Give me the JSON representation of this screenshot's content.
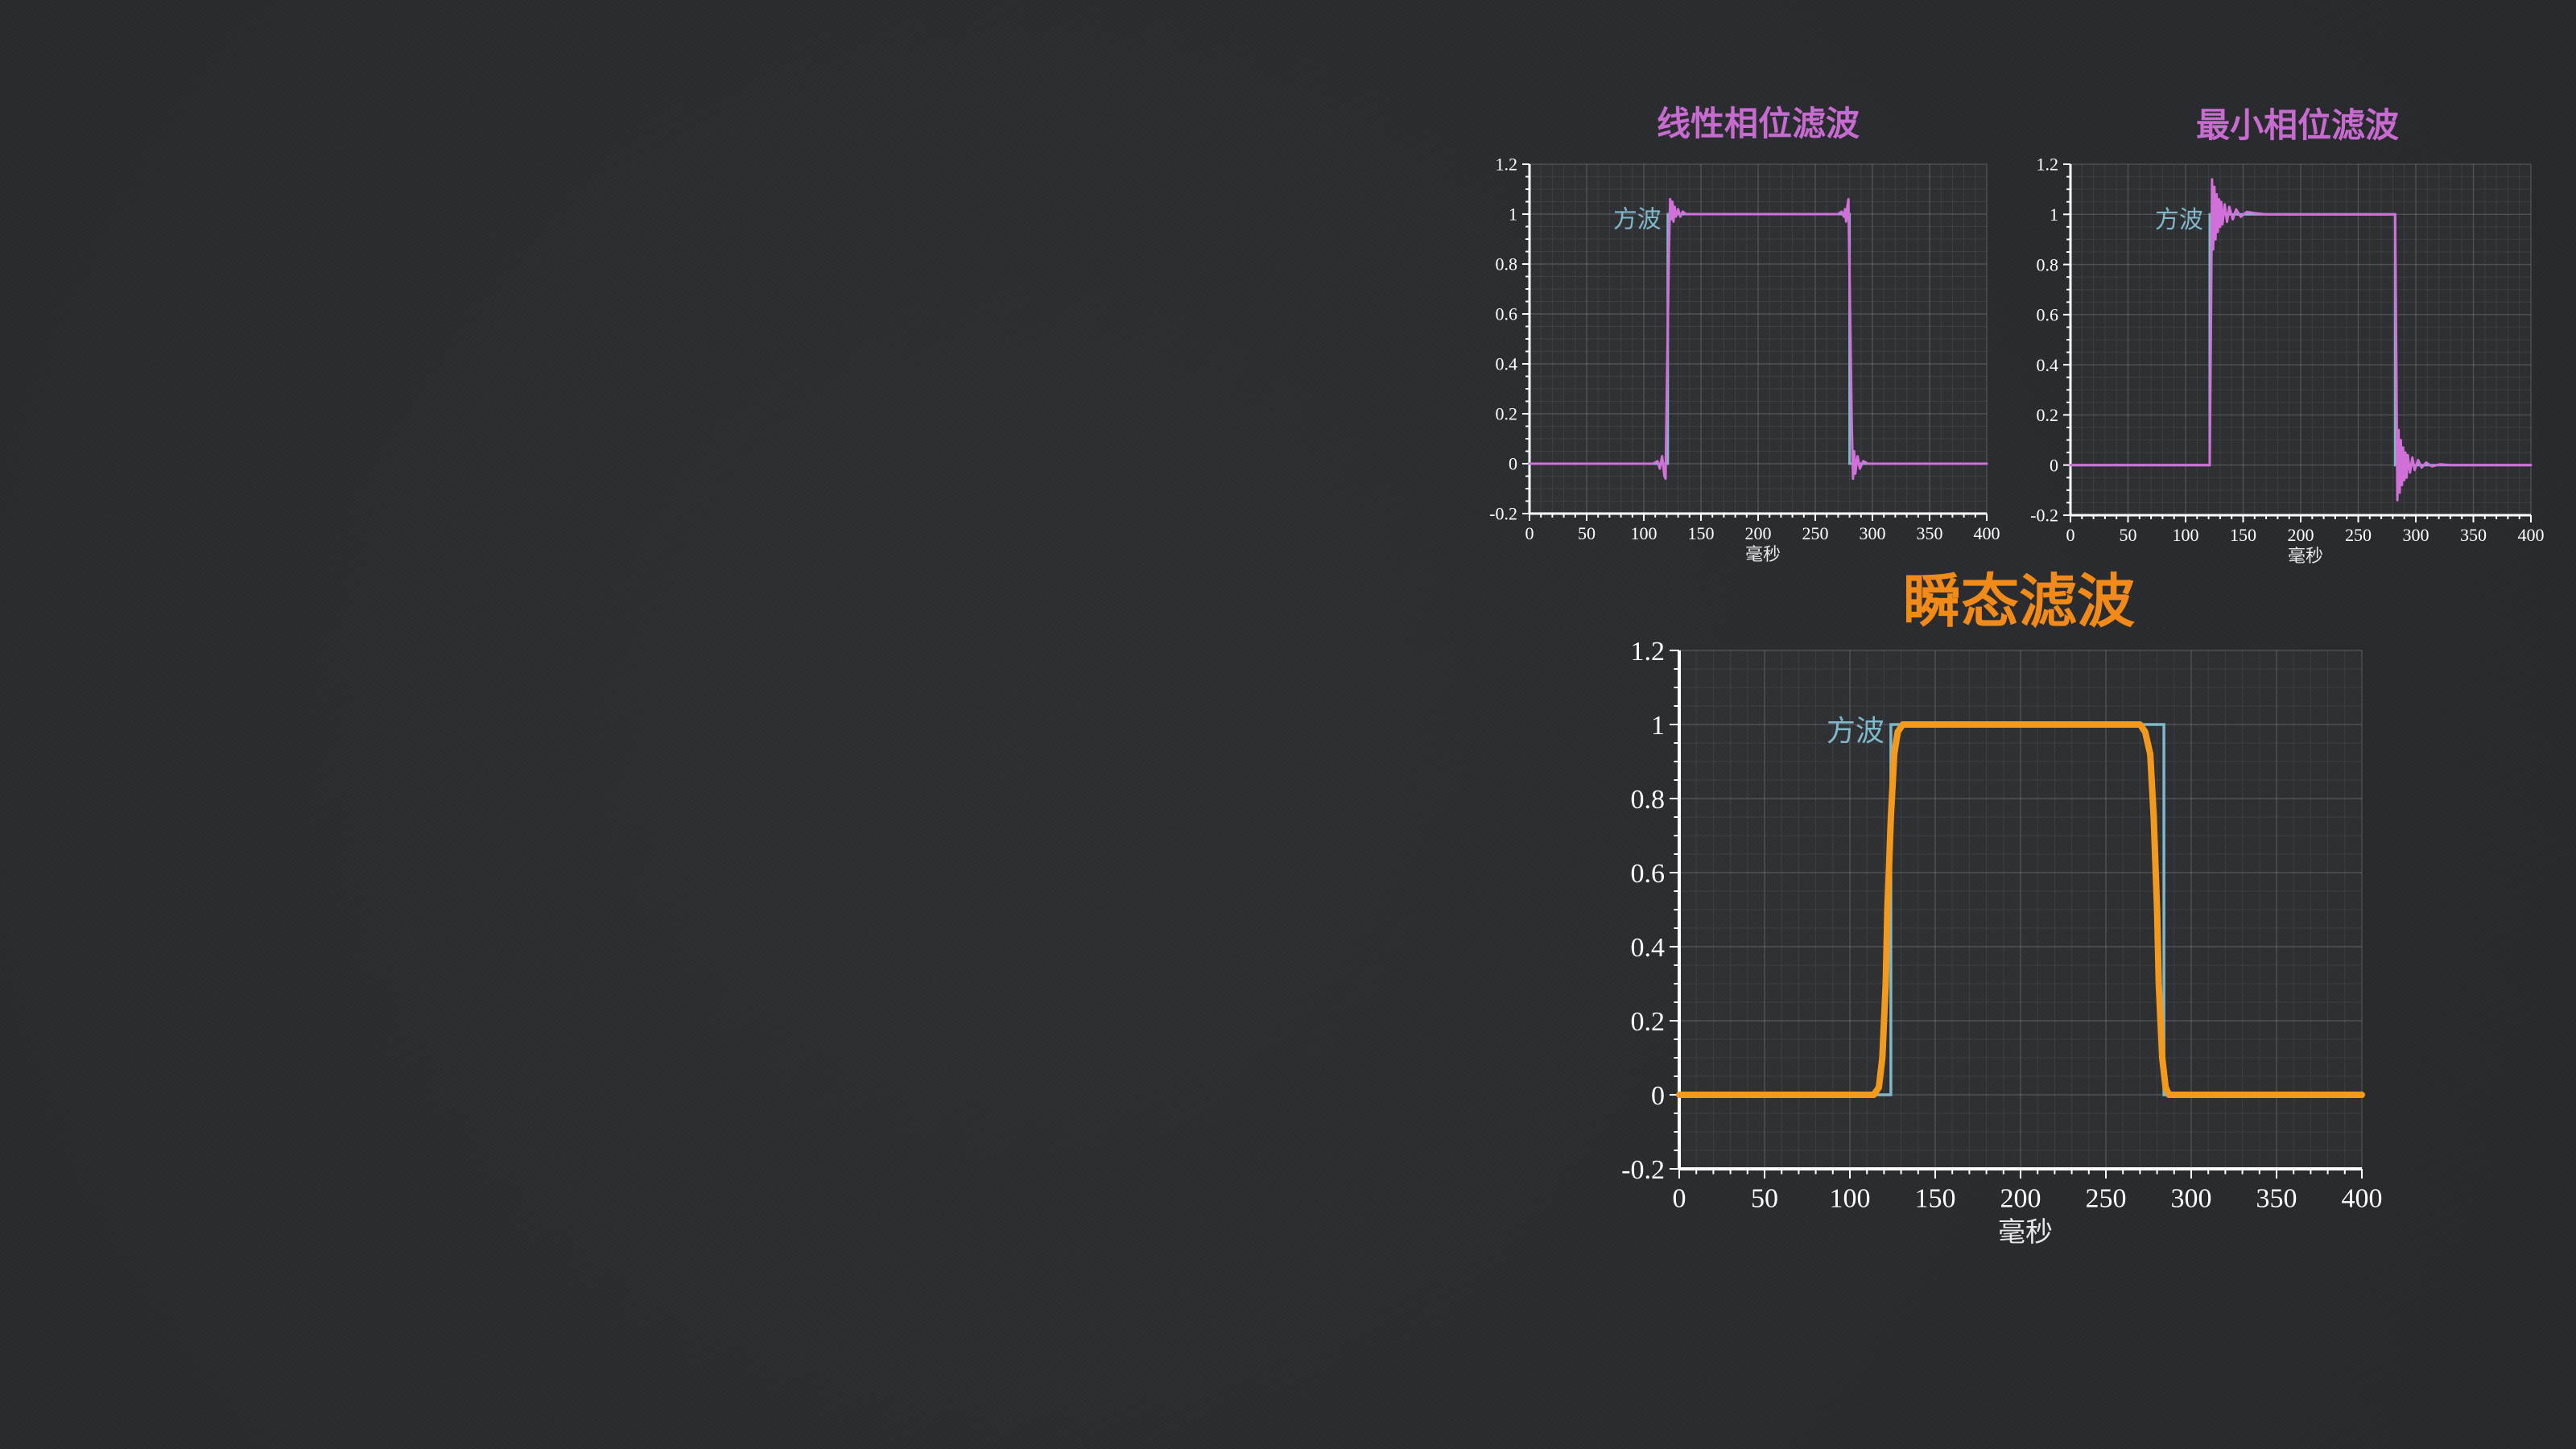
{
  "chart_data": [
    {
      "type": "line",
      "title": "线性相位滤波",
      "xlabel": "毫秒",
      "ylabel": "",
      "xlim": [
        0,
        400
      ],
      "ylim": [
        -0.2,
        1.2
      ],
      "xticks": [
        "0",
        "50",
        "100",
        "150",
        "200",
        "250",
        "300",
        "350",
        "400"
      ],
      "yticks": [
        "-0.2",
        "0",
        "0.2",
        "0.4",
        "0.6",
        "0.8",
        "1",
        "1.2"
      ],
      "grid": true,
      "annotation": "方波",
      "colors": {
        "title": "#c86bd0",
        "reference": "#7fb8c8",
        "filtered": "#d070d8"
      },
      "series": [
        {
          "name": "方波",
          "x": [
            0,
            121,
            121,
            280,
            280,
            400
          ],
          "y": [
            0,
            0,
            1,
            1,
            0,
            0
          ]
        },
        {
          "x": [
            0,
            108,
            112,
            114,
            116,
            118,
            119,
            120,
            121,
            122,
            123,
            124,
            125,
            126,
            127,
            128,
            130,
            132,
            134,
            137,
            270,
            273,
            275,
            276,
            277,
            278,
            279,
            280,
            281,
            282,
            283,
            284,
            285,
            287,
            289,
            292,
            296,
            400
          ],
          "y": [
            0,
            0,
            0.01,
            -0.02,
            0.03,
            -0.05,
            -0.06,
            0.25,
            0.55,
            0.85,
            1.06,
            0.98,
            1.05,
            0.97,
            1.03,
            0.99,
            1.02,
            0.99,
            1.01,
            1,
            1,
            1.01,
            0.99,
            1.02,
            0.97,
            1.03,
            1.06,
            0.75,
            0.45,
            0.15,
            -0.06,
            0.05,
            -0.04,
            0.03,
            -0.02,
            0.01,
            0,
            0
          ]
        }
      ]
    },
    {
      "type": "line",
      "title": "最小相位滤波",
      "xlabel": "毫秒",
      "ylabel": "",
      "xlim": [
        0,
        400
      ],
      "ylim": [
        -0.2,
        1.2
      ],
      "xticks": [
        "0",
        "50",
        "100",
        "150",
        "200",
        "250",
        "300",
        "350",
        "400"
      ],
      "yticks": [
        "-0.2",
        "0",
        "0.2",
        "0.4",
        "0.6",
        "0.8",
        "1",
        "1.2"
      ],
      "grid": true,
      "annotation": "方波",
      "colors": {
        "title": "#c86bd0",
        "reference": "#7fb8c8",
        "filtered": "#d070d8"
      },
      "series": [
        {
          "name": "方波",
          "x": [
            0,
            121,
            121,
            282,
            282,
            400
          ],
          "y": [
            0,
            0,
            1,
            1,
            0,
            0
          ]
        },
        {
          "x": [
            0,
            121,
            122,
            123,
            124,
            125,
            126,
            127,
            128,
            129,
            130,
            131,
            132,
            134,
            136,
            138,
            141,
            144,
            148,
            153,
            160,
            170,
            185,
            282,
            283,
            284,
            285,
            286,
            287,
            288,
            289,
            290,
            291,
            292,
            293,
            295,
            297,
            299,
            302,
            305,
            309,
            314,
            321,
            331,
            346,
            400
          ],
          "y": [
            0,
            0,
            0.55,
            1.14,
            0.86,
            1.11,
            0.9,
            1.08,
            0.93,
            1.06,
            0.95,
            1.05,
            0.96,
            1.04,
            0.97,
            1.03,
            0.98,
            1.02,
            0.99,
            1.01,
            1.005,
            1,
            1,
            1,
            0.45,
            -0.14,
            0.14,
            -0.11,
            0.1,
            -0.08,
            0.07,
            -0.06,
            0.05,
            -0.05,
            0.04,
            -0.03,
            0.03,
            -0.02,
            0.02,
            -0.01,
            0.01,
            -0.005,
            0.003,
            0,
            0,
            0
          ]
        }
      ]
    },
    {
      "type": "line",
      "title": "瞬态滤波",
      "xlabel": "毫秒",
      "ylabel": "",
      "xlim": [
        0,
        400
      ],
      "ylim": [
        -0.2,
        1.2
      ],
      "xticks": [
        "0",
        "50",
        "100",
        "150",
        "200",
        "250",
        "300",
        "350",
        "400"
      ],
      "yticks": [
        "-0.2",
        "0",
        "0.2",
        "0.4",
        "0.6",
        "0.8",
        "1",
        "1.2"
      ],
      "grid": true,
      "annotation": "方波",
      "colors": {
        "title": "#f28a1a",
        "reference": "#7fb8c8",
        "filtered": "#f39a1c"
      },
      "series": [
        {
          "name": "方波",
          "x": [
            0,
            124,
            124,
            284,
            284,
            400
          ],
          "y": [
            0,
            0,
            1,
            1,
            0,
            0
          ]
        },
        {
          "x": [
            0,
            114,
            117,
            119,
            121,
            122,
            124,
            126,
            128,
            131,
            134,
            270,
            273,
            276,
            278,
            280,
            281,
            283,
            285,
            287,
            290,
            400
          ],
          "y": [
            0,
            0,
            0.02,
            0.1,
            0.3,
            0.5,
            0.75,
            0.92,
            0.98,
            1,
            1,
            1,
            0.98,
            0.92,
            0.75,
            0.5,
            0.3,
            0.1,
            0.02,
            0,
            0,
            0
          ]
        }
      ]
    }
  ]
}
